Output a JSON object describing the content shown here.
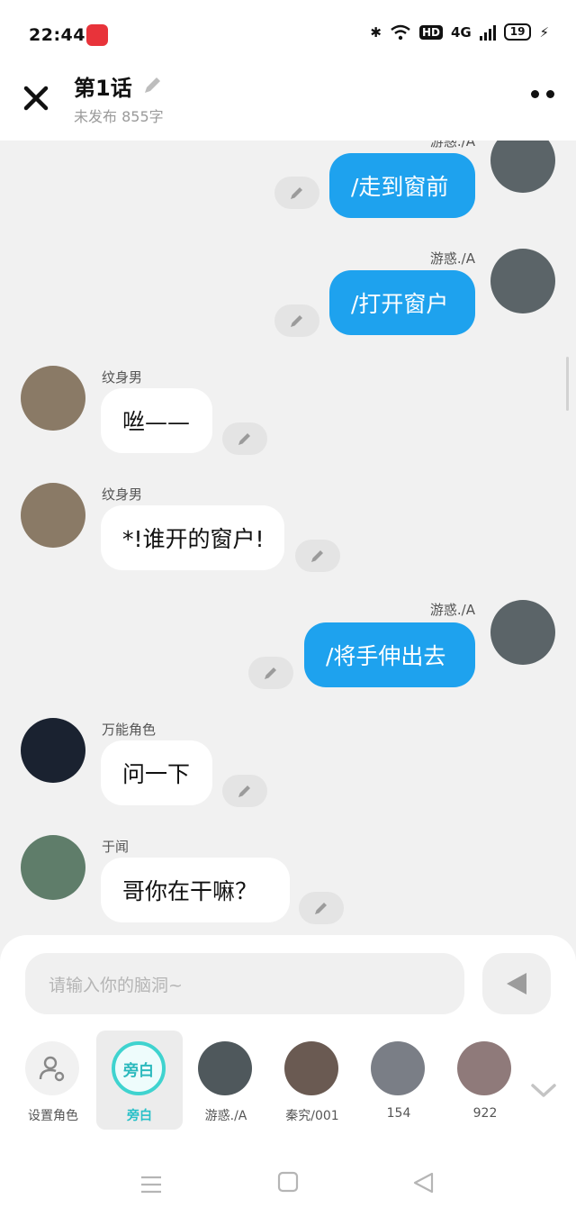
{
  "status_bar": {
    "time": "22:44",
    "bluetooth": "✱",
    "hd": "HD",
    "network": "4G",
    "battery": "19",
    "charging": "⚡"
  },
  "header": {
    "title": "第1话",
    "subtitle": "未发布 855字"
  },
  "messages": [
    {
      "side": "right",
      "name": "游惑./A",
      "text": "/走到窗前",
      "avatar_color": "#5b6468"
    },
    {
      "side": "right",
      "name": "游惑./A",
      "text": "/打开窗户",
      "avatar_color": "#5b6468"
    },
    {
      "side": "left",
      "name": "纹身男",
      "text": "咝——",
      "avatar_color": "#8a7a66"
    },
    {
      "side": "left",
      "name": "纹身男",
      "text": "*!谁开的窗户!",
      "avatar_color": "#8a7a66"
    },
    {
      "side": "right",
      "name": "游惑./A",
      "text": "/将手伸出去",
      "avatar_color": "#5b6468"
    },
    {
      "side": "left",
      "name": "万能角色",
      "text": "问一下",
      "avatar_color": "#1a2230"
    },
    {
      "side": "left",
      "name": "于闻",
      "text": "哥你在干嘛？",
      "avatar_color": "#5f7d6a"
    }
  ],
  "input": {
    "placeholder": "请输入你的脑洞~"
  },
  "characters": [
    {
      "label": "设置角色",
      "type": "setting"
    },
    {
      "label": "旁白",
      "type": "narration",
      "badge": "旁白",
      "selected": true
    },
    {
      "label": "游惑./A",
      "type": "avatar",
      "avatar_color": "#4f585c"
    },
    {
      "label": "秦究/001",
      "type": "avatar",
      "avatar_color": "#6a5a52"
    },
    {
      "label": "154",
      "type": "avatar",
      "avatar_color": "#7a7e86"
    },
    {
      "label": "922",
      "type": "avatar",
      "avatar_color": "#8f7a7a"
    }
  ],
  "colors": {
    "bubble_right": "#1ea2ee",
    "bubble_left": "#ffffff",
    "accent_teal": "#3fd3cf",
    "background": "#f1f1f1"
  }
}
